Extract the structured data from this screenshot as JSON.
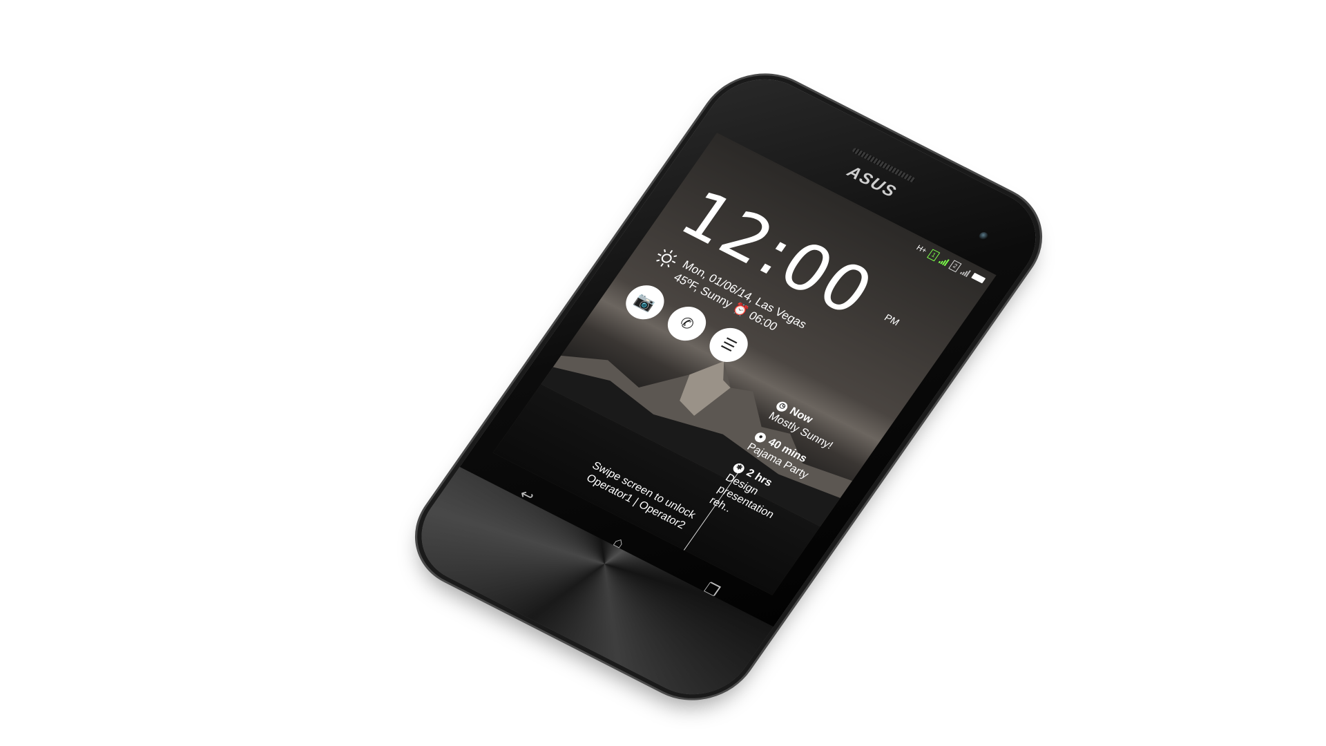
{
  "phone": {
    "brand": "ASUS",
    "status_bar": {
      "sim1_label": "1",
      "sim2_label": "2",
      "network_type": "H+"
    },
    "lock_screen": {
      "time": "12:00",
      "ampm": "PM",
      "date_location": "Mon, 01/06/14, Las Vegas",
      "weather": "45ºF, Sunny",
      "alarm": "06:00",
      "shortcuts": [
        {
          "icon": "camera-icon"
        },
        {
          "icon": "phone-icon"
        },
        {
          "icon": "message-icon"
        }
      ],
      "timeline": [
        {
          "title": "Now",
          "subtitle": "Mostly Sunny!"
        },
        {
          "title": "40 mins",
          "subtitle": "Pajama Party"
        },
        {
          "title": "2 hrs",
          "subtitle": "Design presentation reh.."
        }
      ],
      "unlock_hint": "Swipe screen to unlock",
      "operators": "Operator1 | Operator2"
    },
    "nav_buttons": [
      "back-icon",
      "home-icon",
      "recent-apps-icon"
    ]
  },
  "colors": {
    "background": "#ffffff",
    "body": "#0c0c0c",
    "signal_green": "#7cff4a"
  }
}
